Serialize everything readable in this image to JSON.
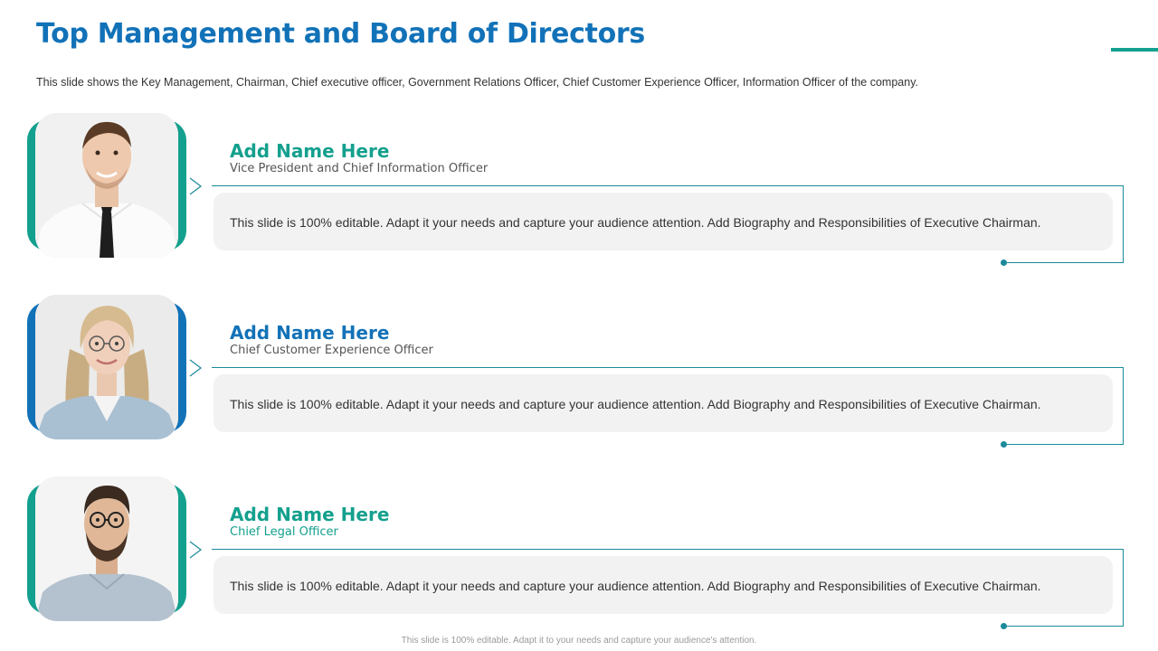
{
  "title": "Top Management and Board of Directors",
  "subtitle": "This slide shows the Key Management, Chairman, Chief executive officer, Government  Relations Officer, Chief Customer Experience Officer, Information  Officer of the company.",
  "colors": {
    "title": "#1272b8",
    "teal": "#14a08e",
    "blue": "#1272b8",
    "frame_line": "#1a8a9a",
    "bio_box": "#f2f2f2"
  },
  "members": [
    {
      "name": "Add Name Here",
      "role": "Vice President and Chief Information Officer",
      "bio": "This slide is 100% editable. Adapt it your needs and capture your audience attention. Add Biography and Responsibilities of Executive Chairman.",
      "name_color": "#14a08e",
      "role_color": "#555555",
      "accent": "teal",
      "photo": "man-in-white-shirt-portrait"
    },
    {
      "name": "Add Name Here",
      "role": "Chief Customer Experience Officer",
      "bio": "This slide is 100% editable. Adapt it your needs and capture your audience attention. Add Biography and Responsibilities of Executive Chairman.",
      "name_color": "#1272b8",
      "role_color": "#555555",
      "accent": "blue",
      "photo": "blonde-woman-with-glasses-portrait"
    },
    {
      "name": "Add Name Here",
      "role": "Chief Legal Officer",
      "bio": "This slide is 100% editable. Adapt it your needs and capture your audience attention. Add Biography and Responsibilities of Executive Chairman.",
      "name_color": "#14a08e",
      "role_color": "#14a08e",
      "accent": "teal",
      "photo": "bearded-man-with-glasses-portrait"
    }
  ],
  "footer": "This slide is 100% editable. Adapt it to your needs and capture your audience's attention."
}
